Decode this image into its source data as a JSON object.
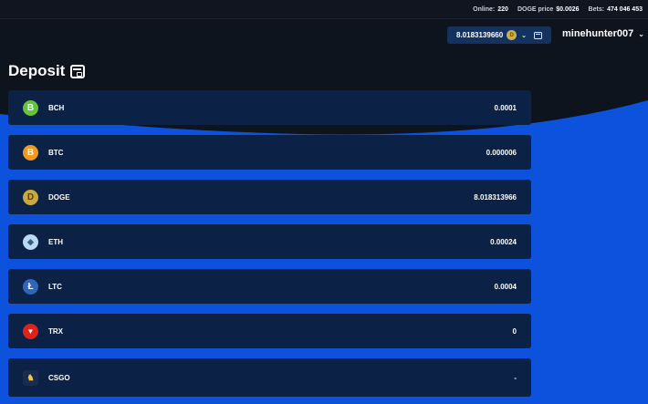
{
  "topbar": {
    "online_label": "Online:",
    "online_value": "220",
    "price_label": "DOGE price",
    "price_value": "$0.0026",
    "bets_label": "Bets:",
    "bets_value": "474 046 453"
  },
  "header": {
    "balance": "8.0183139660",
    "balance_coin_icon": "doge-coin-icon",
    "username": "minehunter007"
  },
  "page": {
    "title": "Deposit",
    "title_icon": "wallet-icon"
  },
  "coins": [
    {
      "symbol": "BCH",
      "value": "0.0001",
      "icon": "bch-icon",
      "glyph": "B"
    },
    {
      "symbol": "BTC",
      "value": "0.000006",
      "icon": "btc-icon",
      "glyph": "B"
    },
    {
      "symbol": "DOGE",
      "value": "8.018313966",
      "icon": "doge-icon",
      "glyph": "D"
    },
    {
      "symbol": "ETH",
      "value": "0.00024",
      "icon": "eth-icon",
      "glyph": "◆"
    },
    {
      "symbol": "LTC",
      "value": "0.0004",
      "icon": "ltc-icon",
      "glyph": "Ł"
    },
    {
      "symbol": "TRX",
      "value": "0",
      "icon": "trx-icon",
      "glyph": "▼"
    },
    {
      "symbol": "CSGO",
      "value": "-",
      "icon": "csgo-icon",
      "glyph": "♞"
    }
  ],
  "colors": {
    "page_dark": "#0e141e",
    "page_blue": "#0d52dc",
    "row_bg": "#0b2146",
    "balance_box": "#14325f"
  }
}
